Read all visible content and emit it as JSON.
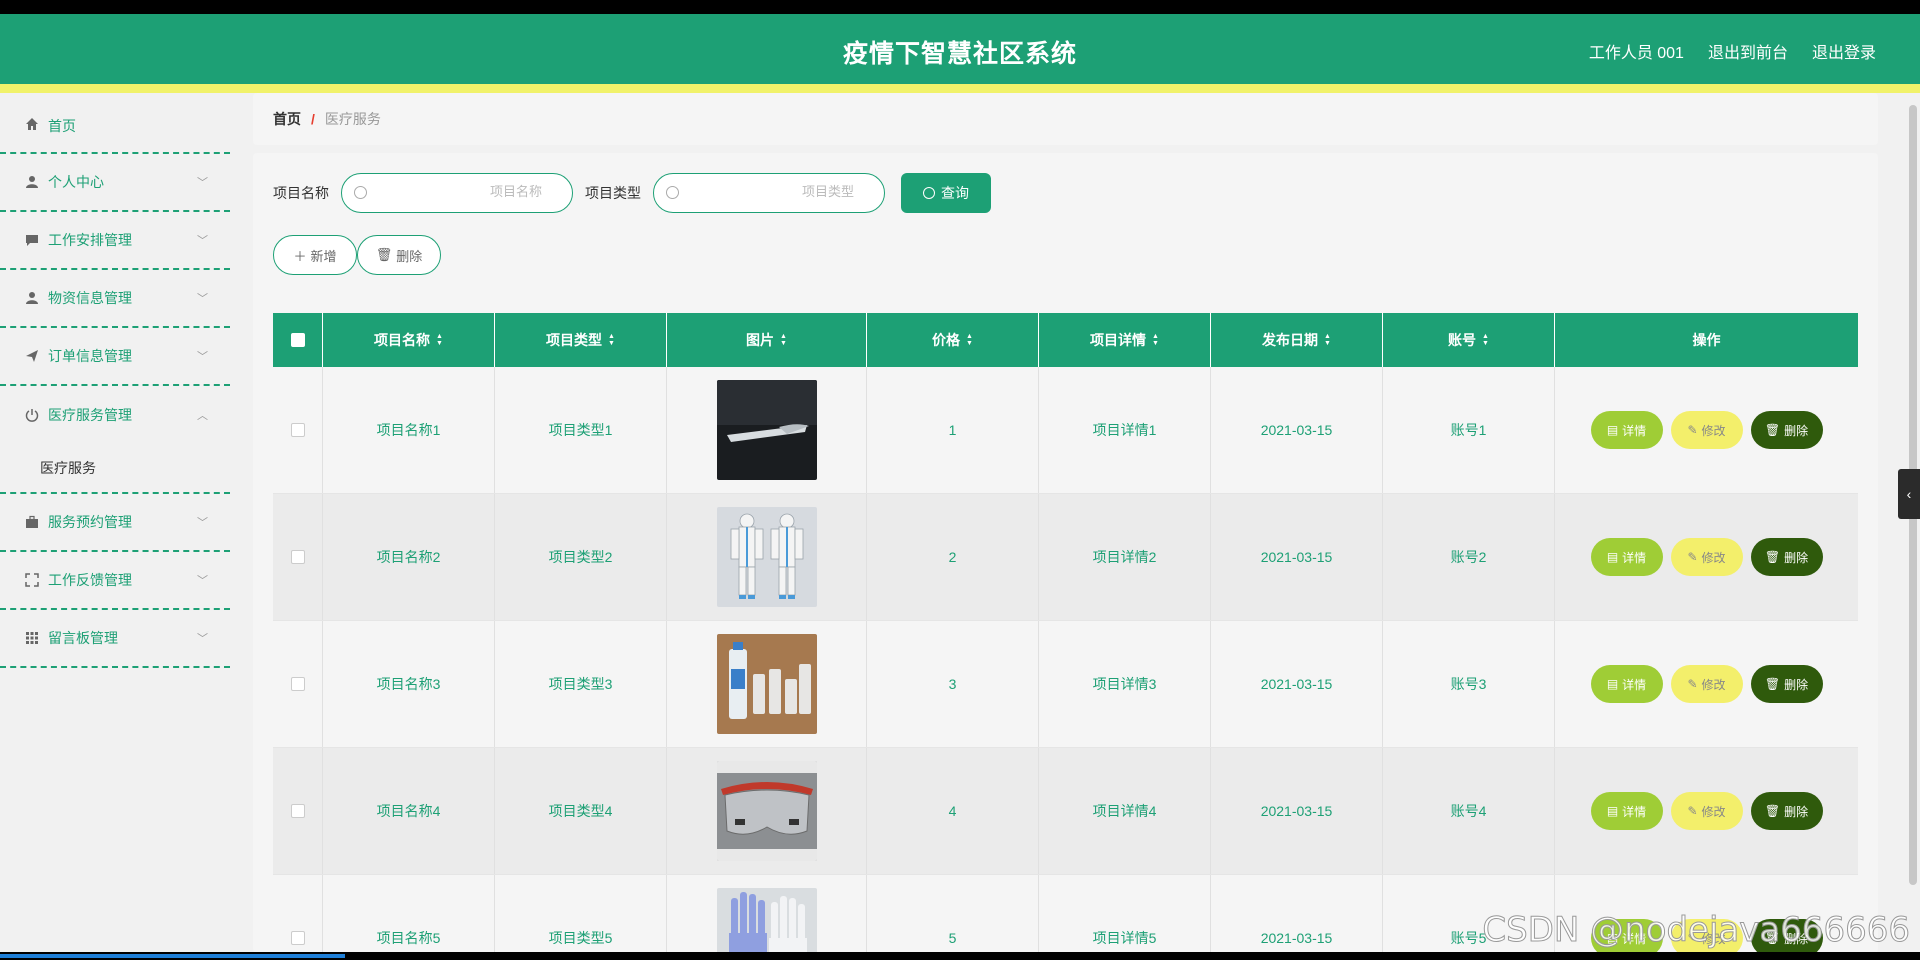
{
  "header": {
    "title": "疫情下智慧社区系统",
    "user": "工作人员 001",
    "to_front": "退出到前台",
    "logout": "退出登录"
  },
  "sidebar": {
    "items": [
      {
        "label": "首页",
        "icon": "home-icon"
      },
      {
        "label": "个人中心",
        "icon": "user-icon"
      },
      {
        "label": "工作安排管理",
        "icon": "chat-icon"
      },
      {
        "label": "物资信息管理",
        "icon": "user-icon"
      },
      {
        "label": "订单信息管理",
        "icon": "send-icon"
      },
      {
        "label": "医疗服务管理",
        "icon": "power-icon"
      },
      {
        "label": "服务预约管理",
        "icon": "briefcase-icon"
      },
      {
        "label": "工作反馈管理",
        "icon": "fullscreen-icon"
      },
      {
        "label": "留言板管理",
        "icon": "grid-icon"
      }
    ],
    "submenu": "医疗服务"
  },
  "breadcrumb": {
    "home": "首页",
    "sep": "/",
    "current": "医疗服务"
  },
  "search": {
    "name_label": "项目名称",
    "name_placeholder": "项目名称",
    "type_label": "项目类型",
    "type_placeholder": "项目类型",
    "query_button": "查询"
  },
  "actions": {
    "add": "新增",
    "delete": "删除"
  },
  "table": {
    "headers": [
      "项目名称",
      "项目类型",
      "图片",
      "价格",
      "项目详情",
      "发布日期",
      "账号",
      "操作"
    ],
    "rows": [
      {
        "name": "项目名称1",
        "type": "项目类型1",
        "price": "1",
        "detail": "项目详情1",
        "date": "2021-03-15",
        "account": "账号1"
      },
      {
        "name": "项目名称2",
        "type": "项目类型2",
        "price": "2",
        "detail": "项目详情2",
        "date": "2021-03-15",
        "account": "账号2"
      },
      {
        "name": "项目名称3",
        "type": "项目类型3",
        "price": "3",
        "detail": "项目详情3",
        "date": "2021-03-15",
        "account": "账号3"
      },
      {
        "name": "项目名称4",
        "type": "项目类型4",
        "price": "4",
        "detail": "项目详情4",
        "date": "2021-03-15",
        "account": "账号4"
      },
      {
        "name": "项目名称5",
        "type": "项目类型5",
        "price": "5",
        "detail": "项目详情5",
        "date": "2021-03-15",
        "account": "账号5"
      }
    ],
    "ops": {
      "detail": "详情",
      "edit": "修改",
      "delete": "删除"
    }
  },
  "watermark": "CSDN @nodejava666666",
  "colors": {
    "primary": "#1da075",
    "yellow_bar": "#f1f26a",
    "detail_btn": "#9fcd36",
    "edit_btn": "#f3ef6b",
    "delete_btn": "#2f5a0c"
  }
}
